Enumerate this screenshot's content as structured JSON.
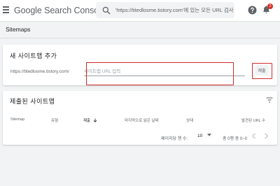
{
  "app": {
    "title": "Google Search Console",
    "search_placeholder": "'https://titedlosme.tistory.com'에 있는 모든 URL 검사",
    "notification_count": "2"
  },
  "page": {
    "title": "Sitemaps"
  },
  "add_sitemap": {
    "title": "새 사이트맵 추가",
    "url_prefix": "https://titedlosme.tistory.com/",
    "input_placeholder": "사이트맵 URL 입력",
    "submit_label": "제출"
  },
  "submitted_sitemaps": {
    "title": "제출된 사이트맵",
    "columns": [
      "Sitemap",
      "유형",
      "제출",
      "마지막으로 읽은 날짜",
      "상태",
      "발견된 URL 수"
    ],
    "pagination": {
      "rows_per_page_label": "페이지당 행 수:",
      "rows_per_page": "10",
      "range": "총 0행 중 0~0"
    }
  },
  "colors": {
    "highlight": "#d22b2b",
    "notification_badge": "#d93025",
    "topbar_bg": "#ffffff",
    "page_bg": "#f1f3f4"
  },
  "icons": [
    "menu-icon",
    "search-icon",
    "help-icon",
    "bell-icon",
    "filter-icon",
    "sort-arrow-icon",
    "caret-down-icon",
    "chevron-left-icon",
    "chevron-right-icon"
  ]
}
